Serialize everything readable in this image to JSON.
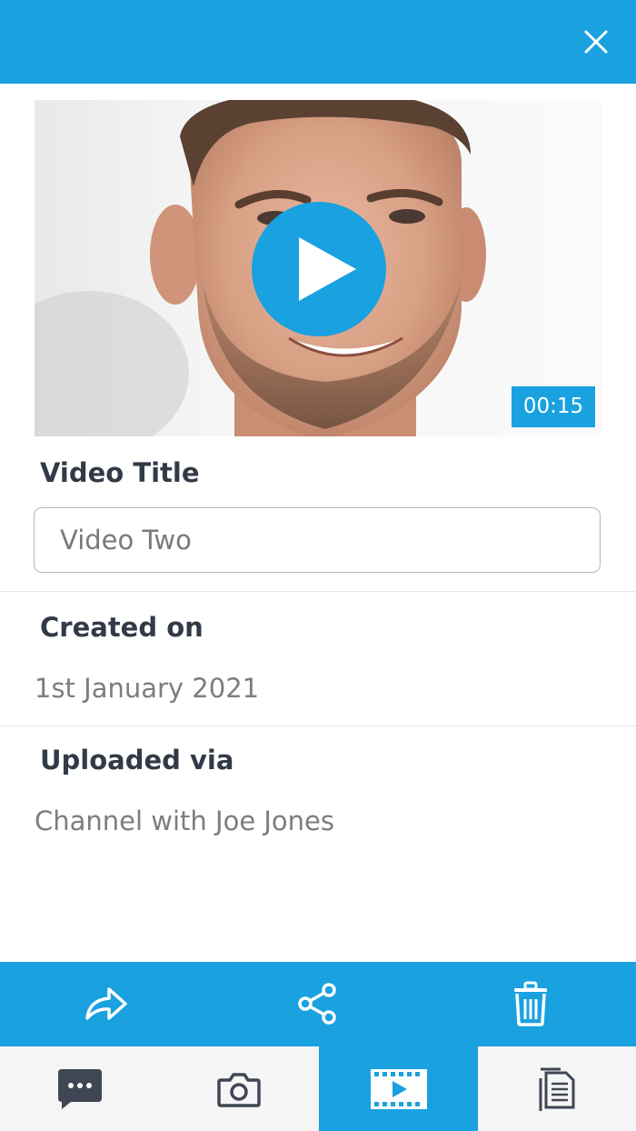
{
  "header": {
    "close_icon": "close-icon",
    "color": "#19a1e0"
  },
  "video": {
    "play_icon": "play-icon",
    "duration": "00:15"
  },
  "details": {
    "title_label": "Video Title",
    "title_value": "Video Two",
    "created_label": "Created on",
    "created_value": "1st January 2021",
    "uploaded_label": "Uploaded via",
    "uploaded_value": "Channel with Joe Jones"
  },
  "actions": [
    {
      "icon": "forward-icon"
    },
    {
      "icon": "share-icon"
    },
    {
      "icon": "trash-icon"
    }
  ],
  "tabs": [
    {
      "icon": "chat-icon",
      "active": false
    },
    {
      "icon": "camera-icon",
      "active": false
    },
    {
      "icon": "video-icon",
      "active": true
    },
    {
      "icon": "documents-icon",
      "active": false
    }
  ],
  "colors": {
    "accent": "#19a1e0",
    "label_text": "#333a47",
    "value_text": "#7d7d7d",
    "tab_bar_bg": "#f5f5f5"
  }
}
